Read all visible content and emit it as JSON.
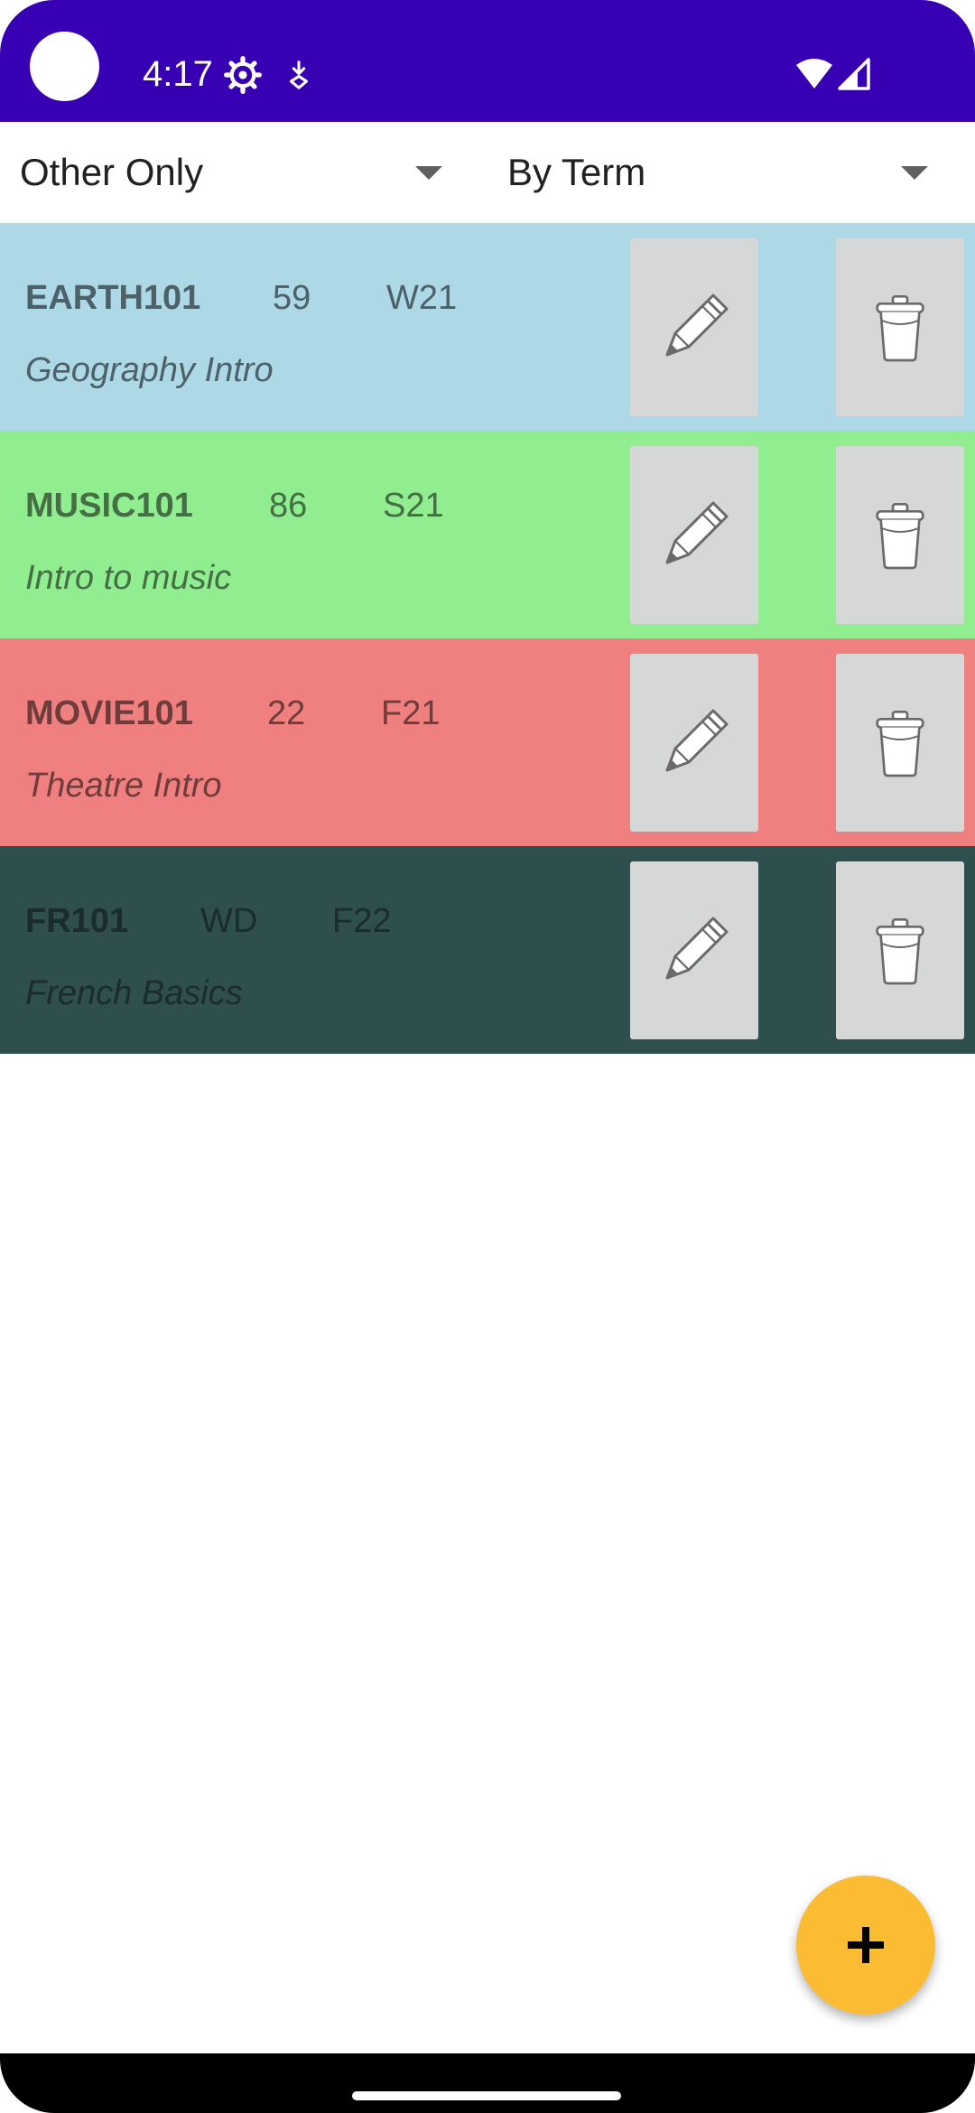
{
  "status_bar": {
    "time": "4:17",
    "background": "#3700b3",
    "icons": [
      "settings-icon",
      "download-icon",
      "wifi-icon",
      "signal-icon"
    ]
  },
  "filters": {
    "type_filter": "Other Only",
    "sort_filter": "By Term"
  },
  "courses": [
    {
      "code": "EARTH101",
      "grade": "59",
      "term": "W21",
      "title": "Geography Intro",
      "bg": "#add8e6",
      "fg": "#4c6168"
    },
    {
      "code": "MUSIC101",
      "grade": "86",
      "term": "S21",
      "title": "Intro to music",
      "bg": "#90ee90",
      "fg": "#456e45"
    },
    {
      "code": "MOVIE101",
      "grade": "22",
      "term": "F21",
      "title": "Theatre Intro",
      "bg": "#f08080",
      "fg": "#6f3b3b"
    },
    {
      "code": "FR101",
      "grade": "WD",
      "term": "F22",
      "title": "French Basics",
      "bg": "#2f4f4f",
      "fg": "#1c2b2b"
    }
  ],
  "actions": {
    "edit_icon": "pencil-icon",
    "delete_icon": "trash-icon"
  },
  "fab": {
    "icon": "plus-icon",
    "color": "#fbbc34"
  }
}
